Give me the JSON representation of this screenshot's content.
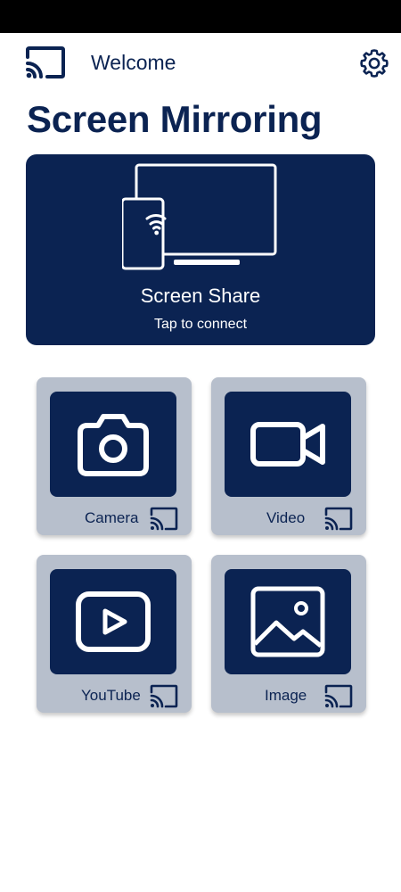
{
  "header": {
    "welcome_label": "Welcome",
    "logo_icon": "cast-icon",
    "settings_icon": "gear-icon"
  },
  "page": {
    "title": "Screen Mirroring"
  },
  "hero": {
    "title": "Screen Share",
    "subtitle": "Tap to connect",
    "icon": "screen-share-icon"
  },
  "tiles": [
    {
      "label": "Camera",
      "icon": "camera-icon",
      "cast_icon": "cast-icon"
    },
    {
      "label": "Video",
      "icon": "video-camera-icon",
      "cast_icon": "cast-icon"
    },
    {
      "label": "YouTube",
      "icon": "youtube-play-icon",
      "cast_icon": "cast-icon"
    },
    {
      "label": "Image",
      "icon": "image-icon",
      "cast_icon": "cast-icon"
    }
  ],
  "colors": {
    "primary": "#0b2352",
    "tile_background": "#b7bfcc",
    "status_bar": "#000000",
    "background": "#ffffff"
  }
}
